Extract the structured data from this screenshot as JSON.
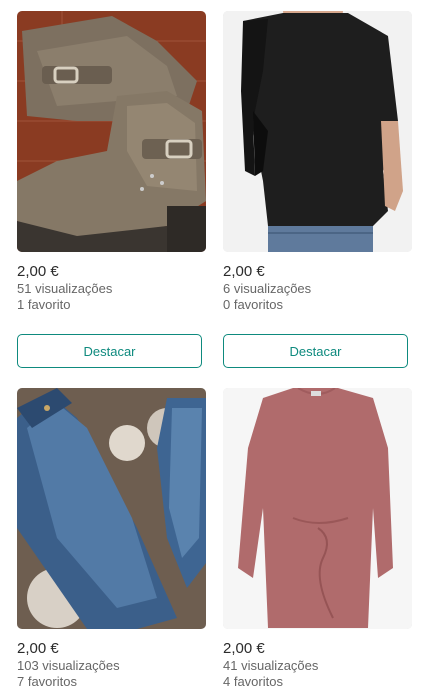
{
  "listings": [
    {
      "image": "brown-suede-ankle-boots",
      "price": "2,00 €",
      "views": "51 visualizações",
      "favorites": "1 favorito",
      "button_label": "Destacar"
    },
    {
      "image": "black-top-tied-sleeves",
      "price": "2,00 €",
      "views": "6 visualizações",
      "favorites": "0 favoritos",
      "button_label": "Destacar"
    },
    {
      "image": "blue-denim-jeans",
      "price": "2,00 €",
      "views": "103 visualizações",
      "favorites": "7 favoritos"
    },
    {
      "image": "pink-long-sleeve-dress",
      "price": "2,00 €",
      "views": "41 visualizações",
      "favorites": "4 favoritos"
    }
  ],
  "colors": {
    "accent": "#0e8a7e",
    "price_text": "#2b2b2b",
    "stat_text": "#666666"
  }
}
